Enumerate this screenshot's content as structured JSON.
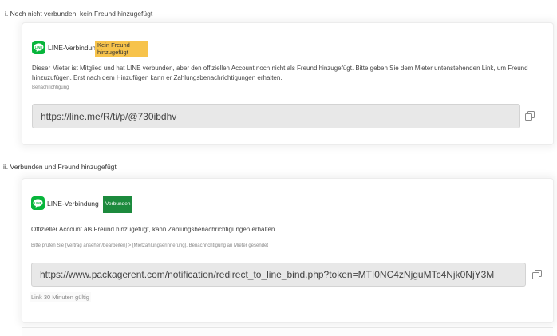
{
  "sections": [
    {
      "label": "i. Noch nicht verbunden, kein Freund hinzugefügt",
      "title": "LINE-Verbindung",
      "badge": "Kein Freund hinzugefügt",
      "description": "Dieser Mieter ist Mitglied und hat LINE verbunden, aber den offiziellen Account noch nicht als Freund hinzugefügt. Bitte geben Sie dem Mieter untenstehenden Link, um Freund hinzuzufügen. Erst nach dem Hinzufügen kann er Zahlungsbenachrichtigungen erhalten.",
      "small_note": "Benachrichtigung",
      "url": "https://line.me/R/ti/p/@730ibdhv"
    },
    {
      "label": "ii. Verbunden und Freund hinzugefügt",
      "title": "LINE-Verbindung",
      "badge": "Verbunden",
      "description": "Offizieller Account als Freund hinzugefügt, kann Zahlungsbenachrichtigungen erhalten.",
      "small_note": "Bitte prüfen Sie [Vertrag ansehen/bearbeiten] > [Mietzahlungserinnerung], Benachrichtigung an Mieter gesendet",
      "url": "https://www.packagerent.com/notification/redirect_to_line_bind.php?token=MTI0NC4zNjguMTc4Njk0NjY3M",
      "hint": "Link 30 Minuten gültig"
    }
  ],
  "icons": {
    "app": "line-icon",
    "copy": "copy-icon"
  },
  "colors": {
    "line_green": "#07b53b",
    "badge_warning": "#f7c34b",
    "badge_success": "#1c8a3d"
  }
}
